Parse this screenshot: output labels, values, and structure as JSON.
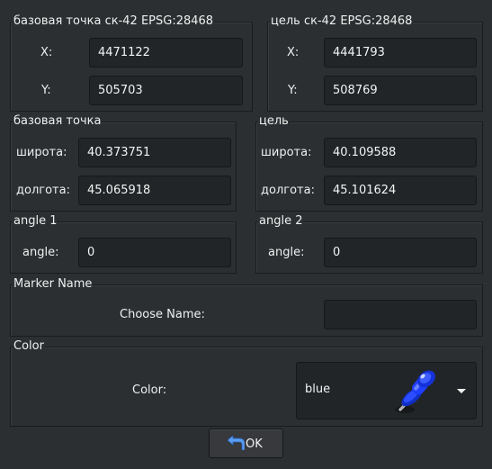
{
  "base_epsg": {
    "title": "базовая точка ск-42 EPSG:28468",
    "x_label": "X:",
    "x_value": "4471122",
    "y_label": "Y:",
    "y_value": "505703"
  },
  "target_epsg": {
    "title": "цель ск-42 EPSG:28468",
    "x_label": "X:",
    "x_value": "4441793",
    "y_label": "Y:",
    "y_value": "508769"
  },
  "base_point": {
    "title": "базовая точка",
    "lat_label": "широта:",
    "lat_value": "40.373751",
    "lon_label": "долгота:",
    "lon_value": "45.065918"
  },
  "target_point": {
    "title": "цель",
    "lat_label": "широта:",
    "lat_value": "40.109588",
    "lon_label": "долгота:",
    "lon_value": "45.101624"
  },
  "angle1": {
    "title": "angle 1",
    "label": "angle:",
    "value": "0"
  },
  "angle2": {
    "title": "angle 2",
    "label": "angle:",
    "value": "0"
  },
  "marker": {
    "title": "Marker Name",
    "label": "Choose Name:",
    "value": ""
  },
  "color": {
    "title": "Color",
    "label": "Color:",
    "selected": "blue",
    "icon": "blue-pushpin-icon",
    "pin_color": "#1f3fff"
  },
  "ok_button": {
    "label": "OK",
    "icon": "back-arrow-icon"
  }
}
